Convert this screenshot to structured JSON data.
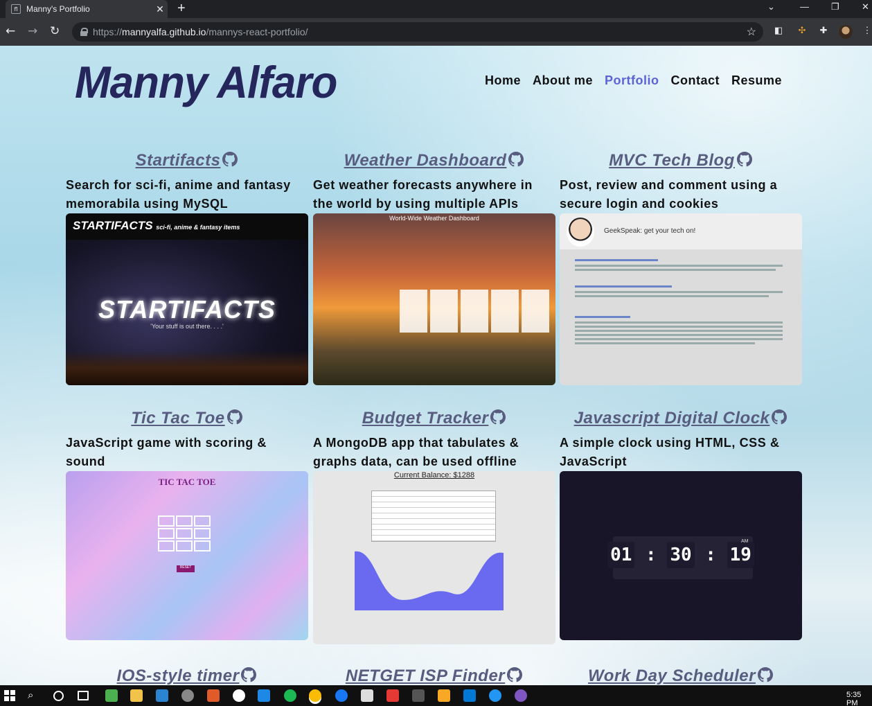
{
  "browser": {
    "tab_title": "Manny's Portfolio",
    "url_prefix": "https://",
    "url_host": "mannyalfa.github.io",
    "url_path": "/mannys-react-portfolio/"
  },
  "site": {
    "brand": "Manny Alfaro",
    "nav": [
      "Home",
      "About me",
      "Portfolio",
      "Contact",
      "Resume"
    ],
    "active_nav": "Portfolio",
    "accent_color": "#5b63d6",
    "brand_color": "#24265c"
  },
  "projects": [
    {
      "title": "Startifacts",
      "desc": "Search for sci-fi, anime and fantasy memorabila using MySQL"
    },
    {
      "title": "Weather Dashboard",
      "desc": "Get weather forecasts anywhere in the world by using multiple APIs"
    },
    {
      "title": "MVC Tech Blog",
      "desc": "Post, review and comment using a secure login and cookies"
    },
    {
      "title": "Tic Tac Toe",
      "desc": "JavaScript game with scoring & sound"
    },
    {
      "title": "Budget Tracker",
      "desc": "A MongoDB app that tabulates & graphs data, can be used offline"
    },
    {
      "title": "Javascript Digital Clock",
      "desc": "A simple clock using HTML, CSS & JavaScript"
    },
    {
      "title": "IOS-style timer"
    },
    {
      "title": "NETGET ISP Finder"
    },
    {
      "title": "Work Day Scheduler"
    }
  ],
  "screenshots": {
    "startifacts_bar": "STARTIFACTS",
    "startifacts_bar_sub": "sci-fi, anime & fantasy items",
    "startifacts_big": "STARTIFACTS",
    "startifacts_tag": "'Your stuff is out there. . . .'",
    "weather_header": "World-Wide Weather Dashboard",
    "blog_header": "GeekSpeak: get your tech on!",
    "ttt_title": "TIC TAC TOE",
    "ttt_reset": "RESET",
    "budget_balance": "Current Balance: $1288",
    "clock_h": "01",
    "clock_m": "30",
    "clock_s": "19",
    "clock_ampm": "AM"
  },
  "taskbar": {
    "time": "5:35 PM"
  }
}
